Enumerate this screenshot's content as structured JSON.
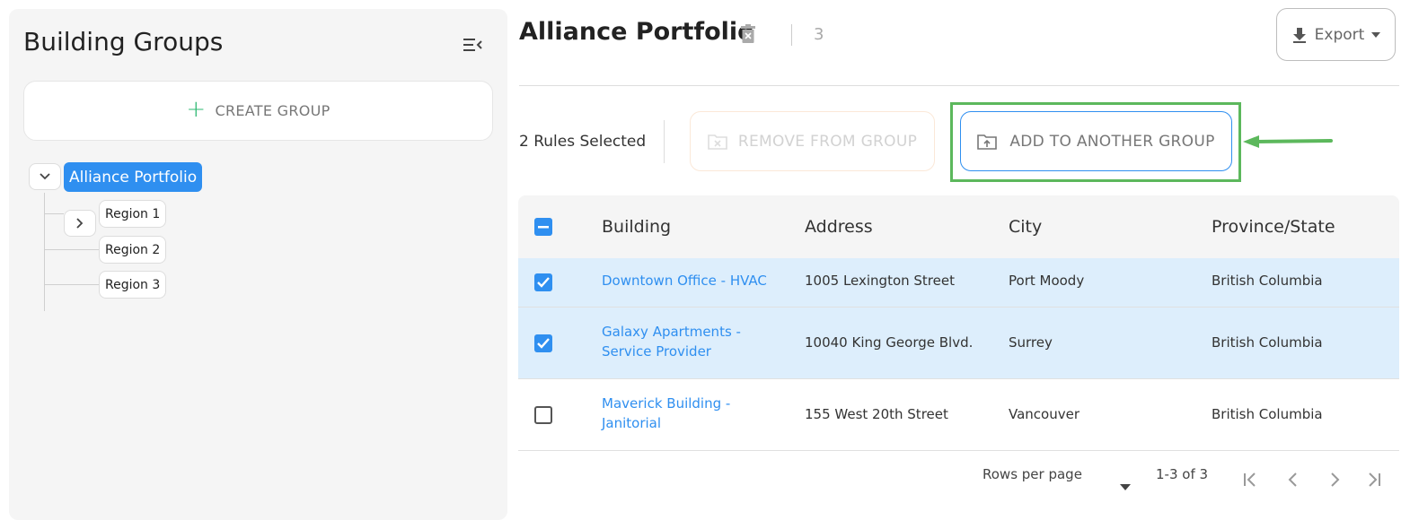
{
  "sidebar": {
    "title": "Building Groups",
    "create_label": "CREATE GROUP",
    "tree": {
      "root": "Alliance Portfolio",
      "children": [
        "Region 1",
        "Region 2",
        "Region 3"
      ]
    }
  },
  "header": {
    "title": "Alliance Portfolio",
    "count": "3",
    "export_label": "Export"
  },
  "actions": {
    "selected_text": "2 Rules Selected",
    "remove_label": "REMOVE FROM GROUP",
    "add_label": "ADD TO ANOTHER GROUP"
  },
  "table": {
    "columns": [
      "Building",
      "Address",
      "City",
      "Province/State"
    ],
    "rows": [
      {
        "selected": true,
        "building_1": "Downtown Office - HVAC",
        "building_2": "",
        "address": "1005 Lexington Street",
        "city": "Port Moody",
        "province": "British Columbia"
      },
      {
        "selected": true,
        "building_1": "Galaxy Apartments -",
        "building_2": "Service Provider",
        "address": "10040 King George Blvd.",
        "city": "Surrey",
        "province": "British Columbia"
      },
      {
        "selected": false,
        "building_1": "Maverick Building -",
        "building_2": "Janitorial",
        "address": "155 West 20th Street",
        "city": "Vancouver",
        "province": "British Columbia"
      }
    ]
  },
  "pagination": {
    "rows_per_page_label": "Rows per page",
    "range": "1-3 of 3"
  },
  "colors": {
    "accent": "#2f8ff0",
    "highlight": "#5cb85c",
    "selected_row": "#ddeefc"
  }
}
